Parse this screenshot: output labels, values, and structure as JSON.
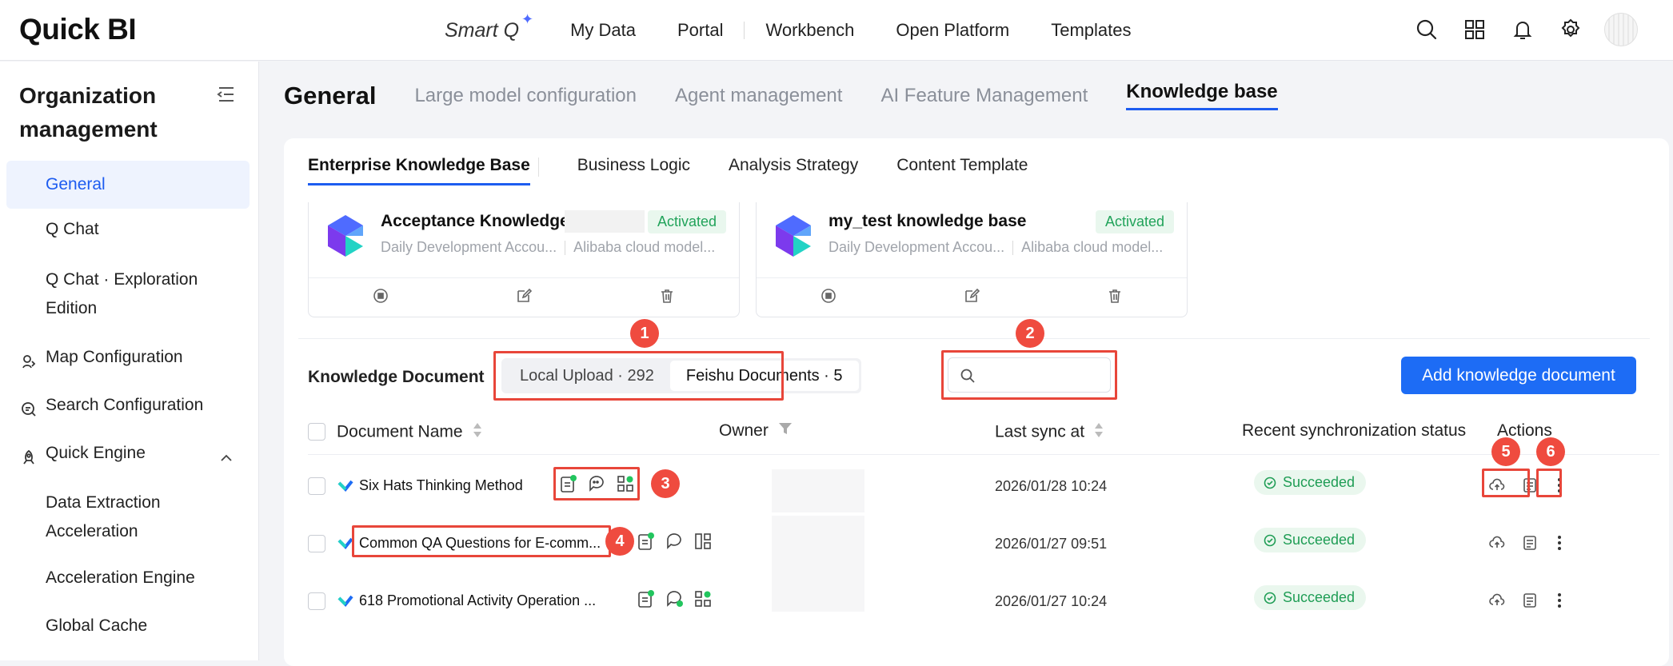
{
  "topbar": {
    "logo": "Quick BI",
    "smart_q": "Smart Q",
    "nav": [
      "My Data",
      "Portal",
      "Workbench",
      "Open Platform",
      "Templates"
    ]
  },
  "sidebar": {
    "title": "Organization management",
    "items": [
      {
        "label": "General",
        "active": true
      },
      {
        "label": "Q Chat"
      },
      {
        "label": "Q Chat · Exploration Edition"
      },
      {
        "label": "Map Configuration"
      },
      {
        "label": "Search Configuration"
      },
      {
        "label": "Quick Engine"
      },
      {
        "label": "Data Extraction Acceleration"
      },
      {
        "label": "Acceleration Engine"
      },
      {
        "label": "Global Cache"
      }
    ]
  },
  "main": {
    "page_title": "General",
    "tabs": [
      "Large model configuration",
      "Agent management",
      "AI Feature Management",
      "Knowledge base"
    ],
    "subtabs": [
      "Enterprise Knowledge Base",
      "Business Logic",
      "Analysis Strategy",
      "Content Template"
    ],
    "kb_cards": [
      {
        "name": "Acceptance Knowledge",
        "status": "Activated",
        "workspace": "Daily Development Accou...",
        "model": "Alibaba cloud model..."
      },
      {
        "name": "my_test knowledge base",
        "status": "Activated",
        "workspace": "Daily Development Accou...",
        "model": "Alibaba cloud model..."
      }
    ],
    "docs": {
      "label": "Knowledge Document",
      "segments": [
        "Local Upload · 292",
        "Feishu Documents · 5"
      ],
      "search_placeholder": "",
      "add_button": "Add knowledge document",
      "columns": [
        "Document Name",
        "Owner",
        "Last sync at",
        "Recent synchronization status",
        "Actions"
      ],
      "rows": [
        {
          "name": "Six Hats Thinking Method",
          "synced": "2026/01/28 10:24",
          "status": "Succeeded"
        },
        {
          "name": "Common QA Questions for E-comm...",
          "synced": "2026/01/27 09:51",
          "status": "Succeeded"
        },
        {
          "name": "618 Promotional Activity Operation ...",
          "synced": "2026/01/27 10:24",
          "status": "Succeeded"
        }
      ]
    },
    "callouts": [
      "1",
      "2",
      "3",
      "4",
      "5",
      "6"
    ]
  },
  "colors": {
    "accent": "#1d6cf5",
    "callout": "#ef4b3f",
    "success": "#1f9d55"
  }
}
